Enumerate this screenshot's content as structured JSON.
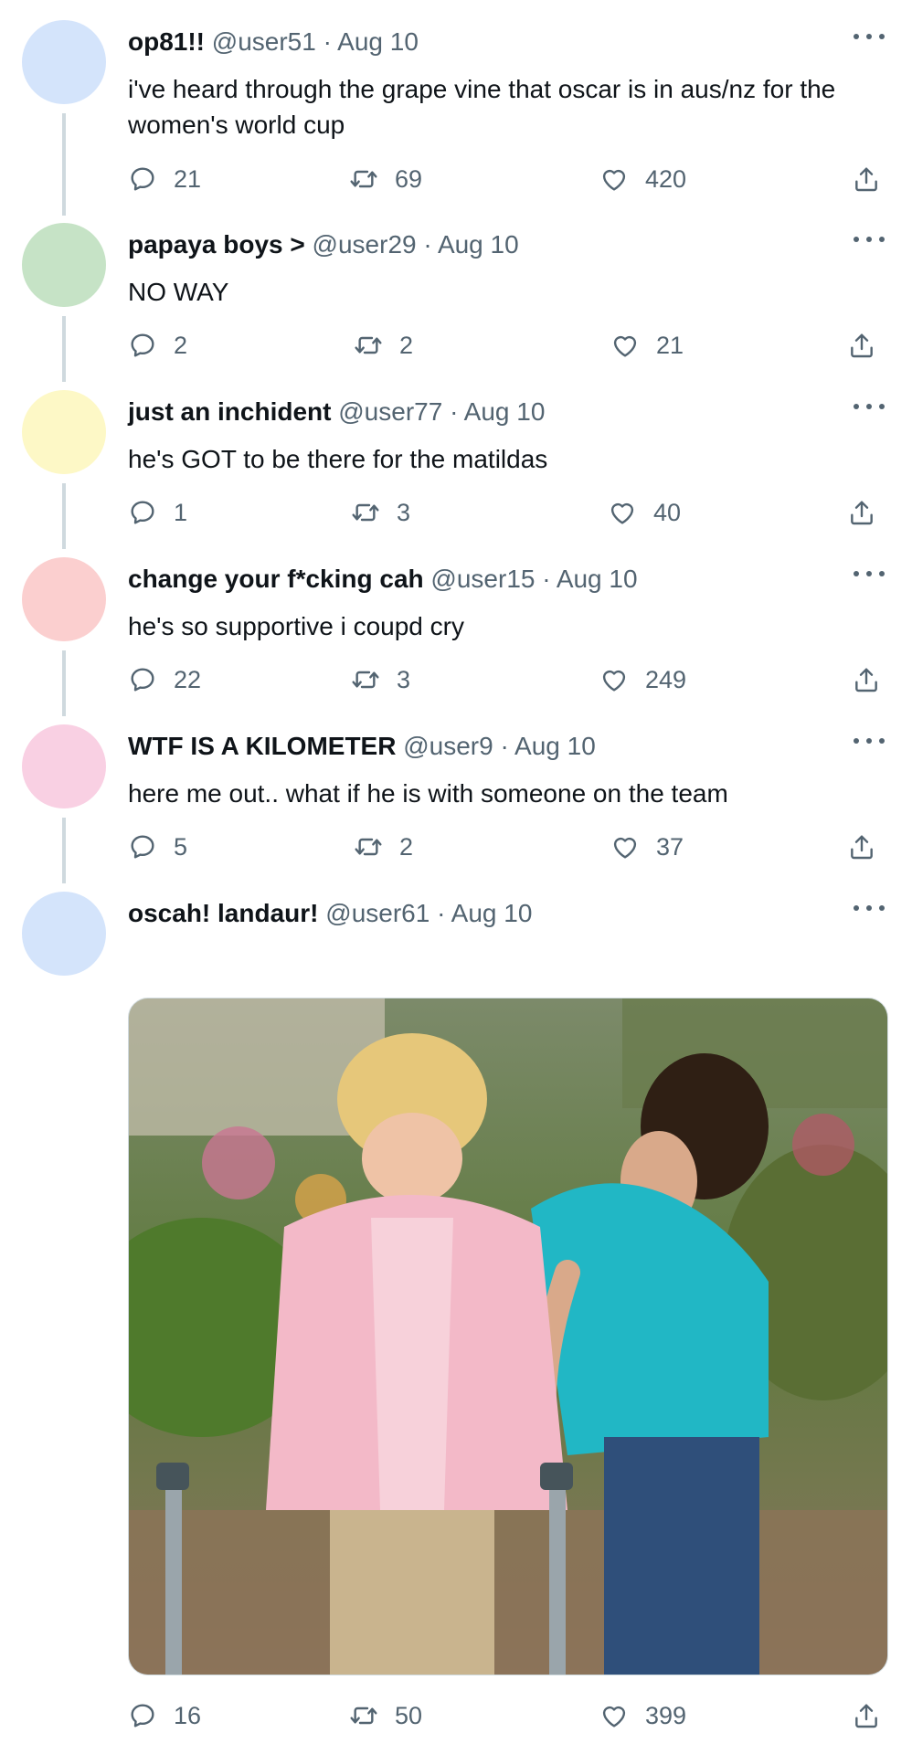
{
  "tweets": [
    {
      "display_name": "op81!!",
      "handle": "@user51",
      "separator": "·",
      "date": "Aug 10",
      "text": "i've heard through the grape vine that oscar is in aus/nz for the women's world cup",
      "avatar_color": "#d4e4fb",
      "replies": "21",
      "retweets": "69",
      "likes": "420"
    },
    {
      "display_name": "papaya boys >",
      "handle": "@user29",
      "separator": "·",
      "date": "Aug 10",
      "text": "NO WAY",
      "avatar_color": "#c6e3c6",
      "replies": "2",
      "retweets": "2",
      "likes": "21"
    },
    {
      "display_name": "just an inchident",
      "handle": "@user77",
      "separator": "·",
      "date": "Aug 10",
      "text": "he's GOT to be there for the matildas",
      "avatar_color": "#fdf8c6",
      "replies": "1",
      "retweets": "3",
      "likes": "40"
    },
    {
      "display_name": "change your f*cking cah",
      "handle": "@user15",
      "separator": "·",
      "date": "Aug 10",
      "text": "he's so supportive i coupd cry",
      "avatar_color": "#fbcfcf",
      "replies": "22",
      "retweets": "3",
      "likes": "249"
    },
    {
      "display_name": "WTF IS A KILOMETER",
      "handle": "@user9",
      "separator": "·",
      "date": "Aug 10",
      "text": "here me out.. what if he is with someone on the team",
      "avatar_color": "#f9d0e3",
      "replies": "5",
      "retweets": "2",
      "likes": "37"
    },
    {
      "display_name": "oscah! landaur!",
      "handle": "@user61",
      "separator": "·",
      "date": "Aug 10",
      "text": "",
      "avatar_color": "#d4e4fb",
      "replies": "16",
      "retweets": "50",
      "likes": "399"
    }
  ],
  "colors": {
    "text_primary": "#0f1419",
    "text_secondary": "#536471",
    "thread_line": "#cfd9de"
  },
  "icons": {
    "reply": "reply-icon",
    "retweet": "retweet-icon",
    "like": "heart-icon",
    "share": "share-icon",
    "more": "more-icon"
  }
}
